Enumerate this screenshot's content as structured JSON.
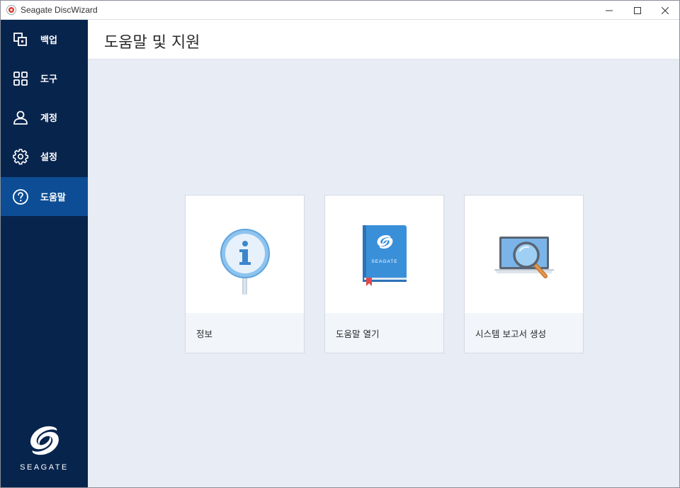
{
  "window": {
    "title": "Seagate DiscWizard"
  },
  "sidebar": {
    "items": [
      {
        "label": "백업",
        "icon": "backup-icon"
      },
      {
        "label": "도구",
        "icon": "tools-grid-icon"
      },
      {
        "label": "계정",
        "icon": "account-icon"
      },
      {
        "label": "설정",
        "icon": "gear-icon"
      },
      {
        "label": "도움말",
        "icon": "help-icon",
        "active": true
      }
    ],
    "brand": "SEAGATE"
  },
  "header": {
    "title": "도움말 및 지원"
  },
  "cards": [
    {
      "label": "정보",
      "icon": "info-icon"
    },
    {
      "label": "도움말 열기",
      "icon": "help-book-icon",
      "book_brand": "SEAGATE"
    },
    {
      "label": "시스템 보고서 생성",
      "icon": "system-report-icon"
    }
  ],
  "colors": {
    "sidebar_bg": "#07244d",
    "sidebar_active": "#0c4d95",
    "content_bg": "#e8ecf4",
    "book_blue": "#3a8fd9"
  }
}
